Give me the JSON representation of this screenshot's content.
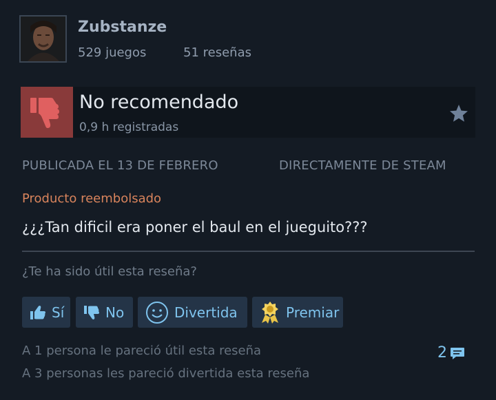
{
  "author": {
    "name": "Zubstanze",
    "games": "529 juegos",
    "reviews": "51 reseñas"
  },
  "verdict": {
    "title": "No recomendado",
    "hours": "0,9 h registradas",
    "icon": "thumbs-down-icon",
    "color": "#893a3a"
  },
  "meta": {
    "posted": "PUBLICADA EL 13 DE FEBRERO",
    "source": "DIRECTAMENTE DE STEAM"
  },
  "refund_status": "Producto reembolsado",
  "review_text": "¿¿¿Tan dificil era poner el baul en el jueguito???",
  "helpful_question": "¿Te ha sido útil esta reseña?",
  "buttons": {
    "yes": "Sí",
    "no": "No",
    "funny": "Divertida",
    "award": "Premiar"
  },
  "stats": {
    "helpful": "A 1 persona le pareció útil esta reseña",
    "funny": "A 3 personas les pareció divertida esta reseña"
  },
  "comments_count": "2",
  "colors": {
    "background": "#141b24",
    "accent": "#7fc4ee",
    "refund": "#d9845c"
  }
}
